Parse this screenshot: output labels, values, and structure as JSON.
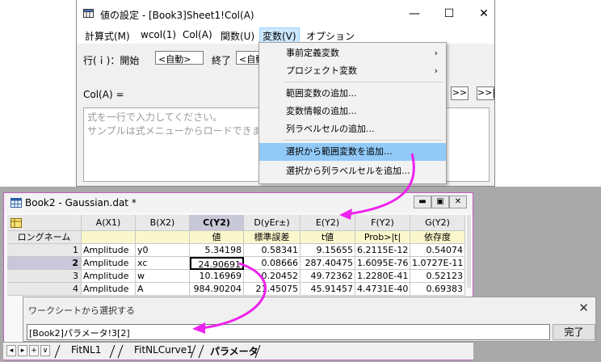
{
  "set_values_dialog": {
    "title": "値の設定 - [Book3]Sheet1!Col(A)",
    "window_buttons": [
      "—",
      "☐",
      "✕"
    ],
    "menu": [
      "計算式(M)",
      "wcol(1)",
      "Col(A)",
      "関数(U)",
      "変数(V)",
      "オプション"
    ],
    "row_label": "行(ｉ)：開始",
    "start_value": "<自動>",
    "end_label": "終了",
    "end_value": "<自動>",
    "col_label": "Col(A) =",
    "nav_buttons": [
      ">>",
      ">>|"
    ],
    "formula_placeholder_line1": "式を一行で入力してください。",
    "formula_placeholder_line2": "サンプルは式メニューからロードできます"
  },
  "variables_menu": {
    "items": [
      {
        "label": "事前定義変数",
        "submenu": true
      },
      {
        "label": "プロジェクト変数",
        "submenu": true
      },
      {
        "label": "範囲変数の追加..."
      },
      {
        "label": "変数情報の追加..."
      },
      {
        "label": "列ラベルセルの追加..."
      },
      {
        "label": "選択から範囲変数を追加...",
        "highlighted": true
      },
      {
        "label": "選択から列ラベルセルを追加..."
      }
    ],
    "submenu_arrow": "›"
  },
  "workbook": {
    "title": "Book2 - Gaussian.dat *",
    "window_buttons": [
      "▬",
      "▣",
      "✕"
    ],
    "columns": [
      "A(X1)",
      "B(X2)",
      "C(Y2)",
      "D(yEr±)",
      "E(Y2)",
      "F(Y2)",
      "G(Y2)"
    ],
    "long_name_label": "ロングネーム",
    "long_names": [
      "",
      "",
      "値",
      "標準誤差",
      "t値",
      "Prob>|t|",
      "依存度"
    ],
    "rows": [
      {
        "num": "1",
        "cells": [
          "Amplitude",
          "y0",
          "5.34198",
          "0.58341",
          "9.15655",
          "6.2115E-12",
          "0.54074"
        ]
      },
      {
        "num": "2",
        "cells": [
          "Amplitude",
          "xc",
          "24.90691",
          "0.08666",
          "287.40475",
          "1.6095E-76",
          "1.0727E-11"
        ]
      },
      {
        "num": "3",
        "cells": [
          "Amplitude",
          "w",
          "10.16969",
          "0.20452",
          "49.72362",
          "1.2280E-41",
          "0.52123"
        ]
      },
      {
        "num": "4",
        "cells": [
          "Amplitude",
          "A",
          "984.90204",
          "21.45075",
          "45.91457",
          "4.4731E-40",
          "0.69383"
        ]
      }
    ],
    "sheet_tabs": [
      "FitNL1",
      "FitNLCurve1",
      "パラメータ"
    ],
    "tab_nav": [
      "◂",
      "▸",
      "+",
      "∨"
    ]
  },
  "select_dialog": {
    "title": "ワークシートから選択する",
    "close": "✕",
    "value": "[Book2]パラメータ!3[2]",
    "done_button": "完了"
  },
  "colors": {
    "arrow": "#ee22ee",
    "highlight": "#91c9f7",
    "label_row": "#fbf7cc",
    "selected_header": "#c8c8d8"
  }
}
